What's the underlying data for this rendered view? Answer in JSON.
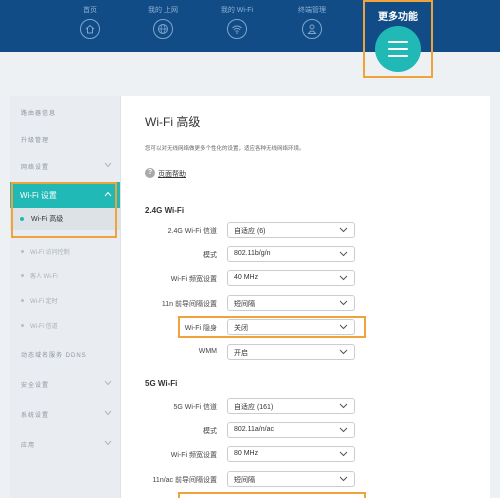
{
  "topnav": {
    "items": [
      {
        "label": "首页",
        "icon": "home-icon"
      },
      {
        "label": "我的 上网",
        "icon": "globe-icon"
      },
      {
        "label": "我的 Wi-Fi",
        "icon": "wifi-icon"
      },
      {
        "label": "终端管理",
        "icon": "user-icon"
      }
    ],
    "more": {
      "label": "更多功能",
      "icon": "menu-icon"
    }
  },
  "sidebar": {
    "items_top": [
      "路由器信息",
      "升级管理",
      "网络设置"
    ],
    "active": "Wi-Fi 设置",
    "active_sub": "Wi-Fi 高级",
    "subs": [
      "Wi-Fi 访问控制",
      "客人 Wi-Fi",
      "Wi-Fi 定时",
      "Wi-Fi 信道"
    ],
    "items_bottom": [
      "动态域名服务 DDNS",
      "安全设置",
      "系统设置",
      "应用"
    ]
  },
  "main": {
    "title": "Wi-Fi 高级",
    "desc": "您可以对无线网络做更多个性化的设置，适应各种无线网络环境。",
    "help": "页面帮助",
    "sec24": {
      "title": "2.4G Wi-Fi",
      "rows": [
        {
          "label": "2.4G Wi-Fi 信道",
          "value": "自适应 (6)"
        },
        {
          "label": "模式",
          "value": "802.11b/g/n"
        },
        {
          "label": "Wi-Fi 频宽设置",
          "value": "40 MHz"
        },
        {
          "label": "11n 前导间隔设置",
          "value": "短间隔"
        },
        {
          "label": "Wi-Fi 隐身",
          "value": "关闭"
        },
        {
          "label": "WMM",
          "value": "开启"
        }
      ]
    },
    "sec5": {
      "title": "5G Wi-Fi",
      "rows": [
        {
          "label": "5G Wi-Fi 信道",
          "value": "自适应 (161)"
        },
        {
          "label": "模式",
          "value": "802.11a/n/ac"
        },
        {
          "label": "Wi-Fi 频宽设置",
          "value": "80 MHz"
        },
        {
          "label": "11n/ac 前导间隔设置",
          "value": "短间隔"
        }
      ]
    }
  },
  "colors": {
    "header": "#114c86",
    "accent": "#21b9b6",
    "highlight": "#f0a33a"
  }
}
